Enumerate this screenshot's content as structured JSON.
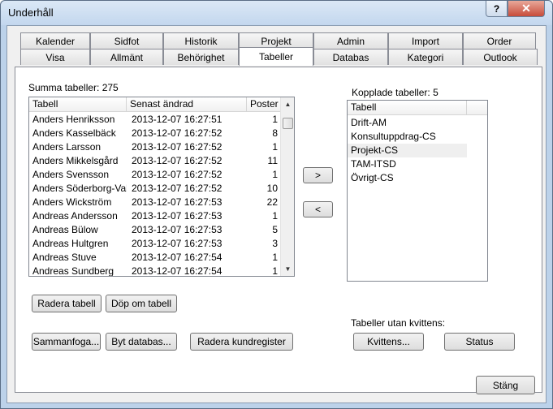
{
  "window": {
    "title": "Underhåll",
    "help_glyph": "?",
    "close_glyph": "✕"
  },
  "tabs_row1": [
    "Kalender",
    "Sidfot",
    "Historik",
    "Projekt",
    "Admin",
    "Import",
    "Order"
  ],
  "tabs_row2": [
    "Visa",
    "Allmänt",
    "Behörighet",
    "Tabeller",
    "Databas",
    "Kategori",
    "Outlook"
  ],
  "active_tab": "Tabeller",
  "left": {
    "summary": "Summa tabeller: 275",
    "columns": [
      "Tabell",
      "Senast ändrad",
      "Poster"
    ],
    "rows": [
      [
        "Anders Henriksson",
        "2013-12-07 16:27:51",
        "1"
      ],
      [
        "Anders Kasselbäck",
        "2013-12-07 16:27:52",
        "8"
      ],
      [
        "Anders Larsson",
        "2013-12-07 16:27:52",
        "1"
      ],
      [
        "Anders Mikkelsgård",
        "2013-12-07 16:27:52",
        "11"
      ],
      [
        "Anders Svensson",
        "2013-12-07 16:27:52",
        "1"
      ],
      [
        "Anders Söderborg-Val",
        "2013-12-07 16:27:52",
        "10"
      ],
      [
        "Anders Wickström",
        "2013-12-07 16:27:53",
        "22"
      ],
      [
        "Andreas Andersson",
        "2013-12-07 16:27:53",
        "1"
      ],
      [
        "Andreas Bülow",
        "2013-12-07 16:27:53",
        "5"
      ],
      [
        "Andreas Hultgren",
        "2013-12-07 16:27:53",
        "3"
      ],
      [
        "Andreas Stuve",
        "2013-12-07 16:27:54",
        "1"
      ],
      [
        "Andreas Sundberg",
        "2013-12-07 16:27:54",
        "1"
      ]
    ]
  },
  "move": {
    "right": ">",
    "left": "<"
  },
  "right": {
    "summary": "Kopplade tabeller: 5",
    "column": "Tabell",
    "rows": [
      "Drift-AM",
      "Konsultuppdrag-CS",
      "Projekt-CS",
      "TAM-ITSD",
      "Övrigt-CS"
    ],
    "highlighted_row": "Projekt-CS"
  },
  "buttons": {
    "delete_table": "Radera tabell",
    "rename_table": "Döp om tabell",
    "merge": "Sammanfoga...",
    "switch_db": "Byt databas...",
    "delete_customer_reg": "Radera kundregister",
    "no_receipt_label": "Tabeller utan kvittens:",
    "receipt": "Kvittens...",
    "status": "Status",
    "close": "Stäng"
  }
}
